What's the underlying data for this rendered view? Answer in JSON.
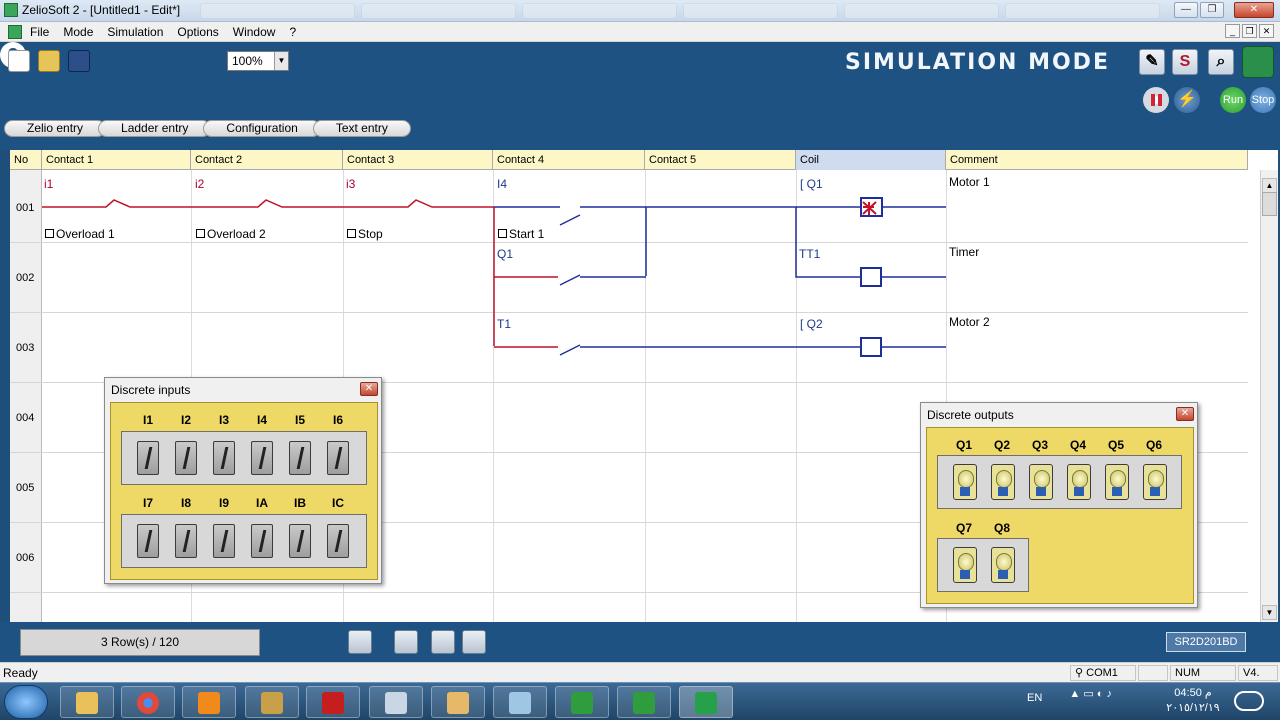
{
  "window": {
    "title": "ZelioSoft 2 - [Untitled1 - Edit*]",
    "menu": [
      "File",
      "Mode",
      "Simulation",
      "Options",
      "Window",
      "?"
    ]
  },
  "toolbar": {
    "zoom_value": "100%",
    "help_label": "?",
    "mode_label": "SIMULATION MODE",
    "s_button": "S",
    "lightning": "⚡",
    "run_label": "Run",
    "stop_label": "Stop"
  },
  "tabs": [
    "Zelio entry",
    "Ladder entry",
    "Configuration",
    "Text entry"
  ],
  "grid": {
    "headers": [
      "No",
      "Contact 1",
      "Contact 2",
      "Contact 3",
      "Contact 4",
      "Contact 5",
      "Coil",
      "Comment"
    ],
    "row_numbers": [
      "001",
      "002",
      "003",
      "004",
      "005",
      "006"
    ],
    "rows": [
      {
        "contacts": [
          "i1",
          "i2",
          "i3",
          "I4"
        ],
        "descriptions": [
          "Overload 1",
          "Overload 2",
          "Stop",
          "Start 1"
        ],
        "coil": "[ Q1",
        "comment": "Motor 1"
      },
      {
        "contacts": [
          "Q1"
        ],
        "coil": "TT1",
        "comment": "Timer"
      },
      {
        "contacts": [
          "T1"
        ],
        "coil": "[ Q2",
        "comment": "Motor 2"
      }
    ]
  },
  "status": {
    "rows_count": "3 Row(s) / 120",
    "device": "SR2D201BD",
    "ready": "Ready",
    "com": "COM1",
    "num": "NUM",
    "version": "V4."
  },
  "discrete_inputs": {
    "title": "Discrete inputs",
    "row1": [
      "I1",
      "I2",
      "I3",
      "I4",
      "I5",
      "I6"
    ],
    "row2": [
      "I7",
      "I8",
      "I9",
      "IA",
      "IB",
      "IC"
    ]
  },
  "discrete_outputs": {
    "title": "Discrete outputs",
    "row1": [
      "Q1",
      "Q2",
      "Q3",
      "Q4",
      "Q5",
      "Q6"
    ],
    "row2": [
      "Q7",
      "Q8"
    ]
  },
  "taskbar": {
    "language": "EN",
    "time": "04:50 م",
    "date": "٢٠١٥/١٢/١٩"
  },
  "colors": {
    "background": "#1e5283",
    "contact_label": "#b0002a",
    "coil_label": "#1f3a8a",
    "wire_active": "#c0122a",
    "wire_inactive": "#1f2f9a",
    "panel_body": "#efd966"
  }
}
